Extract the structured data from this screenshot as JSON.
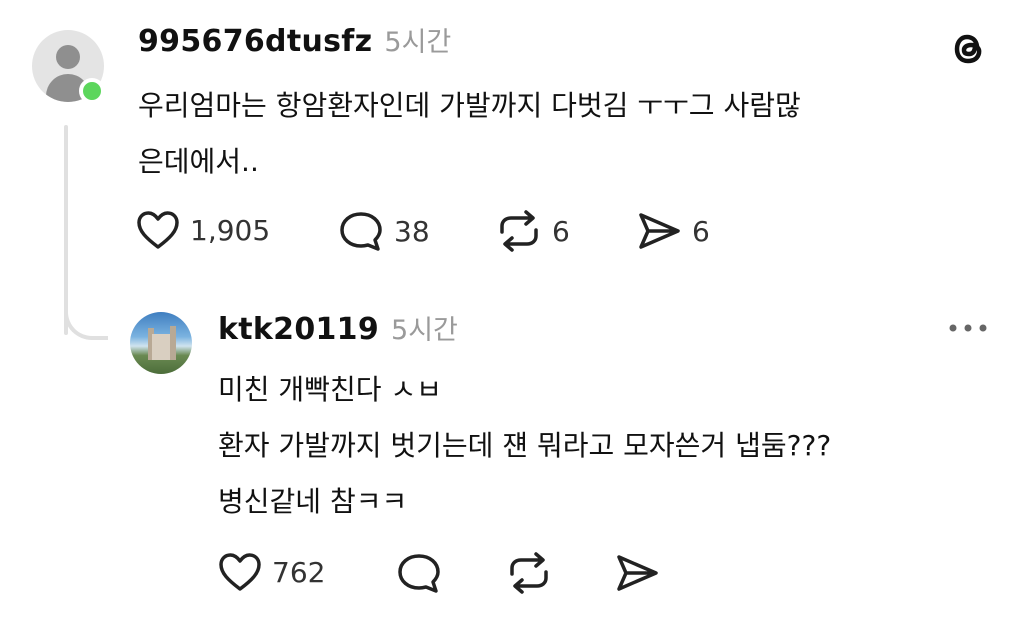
{
  "comment1": {
    "username": "995676dtusfz",
    "time": "5시간",
    "lines": [
      "우리엄마는 항암환자인데 가발까지 다벗김  ㅜㅜ그 사람많",
      "은데에서.."
    ],
    "likes": "1,905",
    "replies": "38",
    "reposts": "6",
    "shares": "6"
  },
  "comment2": {
    "username": "ktk20119",
    "time": "5시간",
    "lines": [
      "미친 개빡친다 ㅅㅂ",
      "환자 가발까지 벗기는데 쟨 뭐라고 모자쓴거 냅둠???",
      "병신같네 참ㅋㅋ"
    ],
    "likes": "762"
  }
}
